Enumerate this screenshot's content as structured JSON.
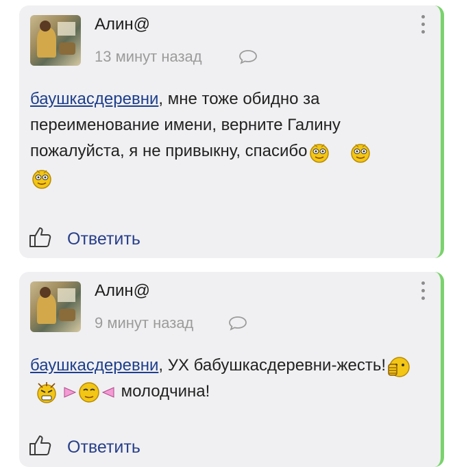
{
  "comments": [
    {
      "author": "Алин@",
      "time": "13 минут назад",
      "mention": "баушкасдеревни",
      "text": ", мне тоже обидно за переименование имени, верните Галину пожалуйста, я не привыкну, спасибо",
      "smileys": [
        "smiley-icon",
        "smiley-icon",
        "smiley-icon"
      ],
      "reply_label": "Ответить"
    },
    {
      "author": "Алин@",
      "time": "9 минут назад",
      "mention": "баушкасдеревни",
      "text_before": ", УХ бабушкасдеревни-жесть!",
      "text_after": " молодчина!",
      "smileys": [
        "thumbs-up-smiley-icon",
        "angry-smiley-icon",
        "candy-smiley-icon"
      ],
      "reply_label": "Ответить"
    }
  ],
  "colors": {
    "accent_border": "#79d36b",
    "link": "#1d3e8c",
    "reply": "#283f8a"
  }
}
